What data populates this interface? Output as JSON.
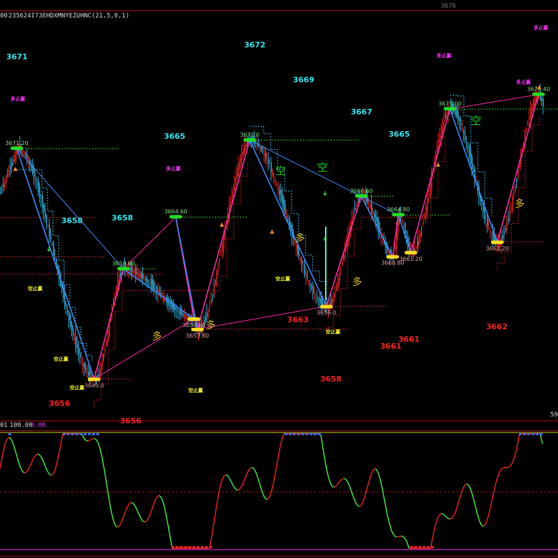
{
  "header": {
    "left_code": "00",
    "indicator_title": "235624I73EHDXMNYEZUHNC(21,5,0,1)",
    "top_right_value": "3676"
  },
  "sub_panel": {
    "title": "01",
    "level_value": "100.00",
    "current_value": "0.00",
    "right_label": "59"
  },
  "colors": {
    "background": "#000000",
    "bull_candle": "#e02020",
    "bear_candle": "#2aa7d0",
    "zigzag_up": "#ff2aa6",
    "zigzag_down": "#3a8cff",
    "pivot_high_marker": "#22dd22",
    "pivot_low_marker": "#ffe020",
    "resistance_line": "#22cc22",
    "support_line": "#cc2222",
    "trail_up": "#49c7ef",
    "trail_down": "#cc2222",
    "oscillator_up": "#ff2020",
    "oscillator_down": "#40ff40",
    "big_label_cyan": "#30e8f0",
    "big_label_red": "#ff2020",
    "small_label_magenta": "#ff30ff",
    "small_label_yellow": "#ffff30"
  },
  "chart_data": {
    "type": "candlestick",
    "ylim": [
      3646,
      3680
    ],
    "pivots": [
      {
        "label": "3671.20",
        "kind": "high"
      },
      {
        "label": "3649.0",
        "kind": "low"
      },
      {
        "label": "3659.60",
        "kind": "high"
      },
      {
        "label": "3654.80",
        "kind": "low"
      },
      {
        "label": "3664.60",
        "kind": "high"
      },
      {
        "label": "3653.80",
        "kind": "low"
      },
      {
        "label": "3672.0",
        "kind": "high"
      },
      {
        "label": "3656.0",
        "kind": "low"
      },
      {
        "label": "3666.60",
        "kind": "high"
      },
      {
        "label": "3660.80",
        "kind": "low"
      },
      {
        "label": "3664.80",
        "kind": "high"
      },
      {
        "label": "3661.20",
        "kind": "low"
      },
      {
        "label": "3675.00",
        "kind": "high"
      },
      {
        "label": "3662.20",
        "kind": "low"
      },
      {
        "label": "3676.40",
        "kind": "high"
      }
    ],
    "big_labels": [
      {
        "text": "3671",
        "color": "cyan"
      },
      {
        "text": "3672",
        "color": "cyan"
      },
      {
        "text": "3669",
        "color": "cyan"
      },
      {
        "text": "3667",
        "color": "cyan"
      },
      {
        "text": "3665",
        "color": "cyan"
      },
      {
        "text": "3665",
        "color": "cyan"
      },
      {
        "text": "3658",
        "color": "cyan"
      },
      {
        "text": "3658",
        "color": "cyan"
      },
      {
        "text": "3656",
        "color": "red"
      },
      {
        "text": "3656",
        "color": "red"
      },
      {
        "text": "3663",
        "color": "red"
      },
      {
        "text": "3661",
        "color": "red"
      },
      {
        "text": "3661",
        "color": "red"
      },
      {
        "text": "3662",
        "color": "red"
      },
      {
        "text": "3658",
        "color": "red"
      }
    ],
    "signals": [
      {
        "text": "多止赢",
        "color": "magenta"
      },
      {
        "text": "多止赢",
        "color": "magenta"
      },
      {
        "text": "多止赢",
        "color": "magenta"
      },
      {
        "text": "多止赢",
        "color": "magenta"
      },
      {
        "text": "多止赢",
        "color": "magenta"
      },
      {
        "text": "空止赢",
        "color": "yellow"
      },
      {
        "text": "空止赢",
        "color": "yellow"
      },
      {
        "text": "空止赢",
        "color": "yellow"
      },
      {
        "text": "空止赢",
        "color": "yellow"
      },
      {
        "text": "空止赢",
        "color": "yellow"
      },
      {
        "text": "空止赢",
        "color": "yellow"
      },
      {
        "text": "空",
        "color": "green"
      },
      {
        "text": "空",
        "color": "green"
      },
      {
        "text": "空",
        "color": "green"
      },
      {
        "text": "多",
        "color": "yellow"
      },
      {
        "text": "多",
        "color": "yellow"
      },
      {
        "text": "多",
        "color": "yellow"
      },
      {
        "text": "多",
        "color": "yellow"
      },
      {
        "text": "多",
        "color": "yellow"
      }
    ],
    "oscillator": {
      "ylim": [
        0,
        100
      ],
      "levels": [
        100,
        50,
        0
      ]
    }
  }
}
